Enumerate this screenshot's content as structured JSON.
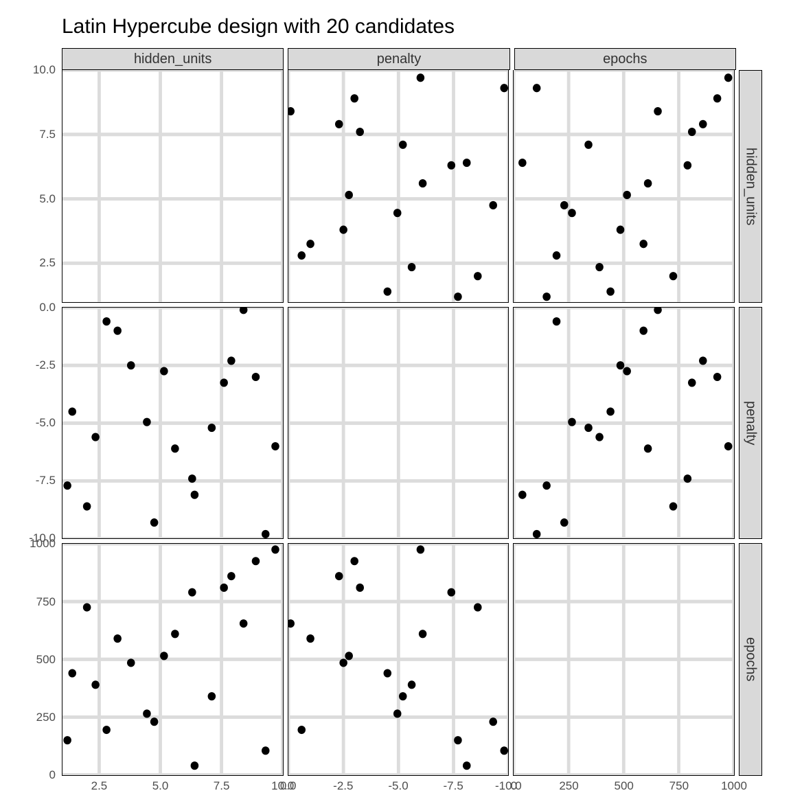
{
  "chart_data": {
    "type": "scatter",
    "title": "Latin Hypercube design with 20 candidates",
    "vars": [
      "hidden_units",
      "penalty",
      "epochs"
    ],
    "ranges": {
      "hidden_units": [
        1,
        10
      ],
      "penalty": [
        -10,
        0
      ],
      "epochs": [
        0,
        1000
      ]
    },
    "ticks": {
      "hidden_units": {
        "major": [
          2.5,
          5.0,
          7.5,
          10.0
        ],
        "labels": [
          "2.5",
          "5.0",
          "7.5",
          "10.0"
        ]
      },
      "penalty": {
        "major": [
          -10.0,
          -7.5,
          -5.0,
          -2.5,
          0.0
        ],
        "labels": [
          "-10.0",
          "-7.5",
          "-5.0",
          "-2.5",
          "0.0"
        ]
      },
      "epochs": {
        "major": [
          0,
          250,
          500,
          750,
          1000
        ],
        "labels": [
          "0",
          "250",
          "500",
          "750",
          "1000"
        ]
      }
    },
    "x_tick_invert": {
      "penalty": true
    },
    "points": [
      {
        "hidden_units": 9.3,
        "penalty": -9.8,
        "epochs": 105
      },
      {
        "hidden_units": 4.75,
        "penalty": -9.3,
        "epochs": 230
      },
      {
        "hidden_units": 2.0,
        "penalty": -8.6,
        "epochs": 725
      },
      {
        "hidden_units": 6.4,
        "penalty": -8.1,
        "epochs": 40
      },
      {
        "hidden_units": 1.2,
        "penalty": -7.7,
        "epochs": 150
      },
      {
        "hidden_units": 6.3,
        "penalty": -7.4,
        "epochs": 790
      },
      {
        "hidden_units": 9.7,
        "penalty": -6.0,
        "epochs": 975
      },
      {
        "hidden_units": 5.6,
        "penalty": -6.1,
        "epochs": 610
      },
      {
        "hidden_units": 2.35,
        "penalty": -5.6,
        "epochs": 390
      },
      {
        "hidden_units": 7.1,
        "penalty": -5.2,
        "epochs": 340
      },
      {
        "hidden_units": 4.45,
        "penalty": -4.95,
        "epochs": 265
      },
      {
        "hidden_units": 1.4,
        "penalty": -4.5,
        "epochs": 440
      },
      {
        "hidden_units": 7.6,
        "penalty": -3.25,
        "epochs": 810
      },
      {
        "hidden_units": 8.9,
        "penalty": -3.0,
        "epochs": 925
      },
      {
        "hidden_units": 5.15,
        "penalty": -2.75,
        "epochs": 515
      },
      {
        "hidden_units": 3.8,
        "penalty": -2.5,
        "epochs": 485
      },
      {
        "hidden_units": 7.9,
        "penalty": -2.3,
        "epochs": 860
      },
      {
        "hidden_units": 3.25,
        "penalty": -1.0,
        "epochs": 590
      },
      {
        "hidden_units": 2.8,
        "penalty": -0.6,
        "epochs": 195
      },
      {
        "hidden_units": 8.4,
        "penalty": -0.1,
        "epochs": 655
      }
    ]
  }
}
